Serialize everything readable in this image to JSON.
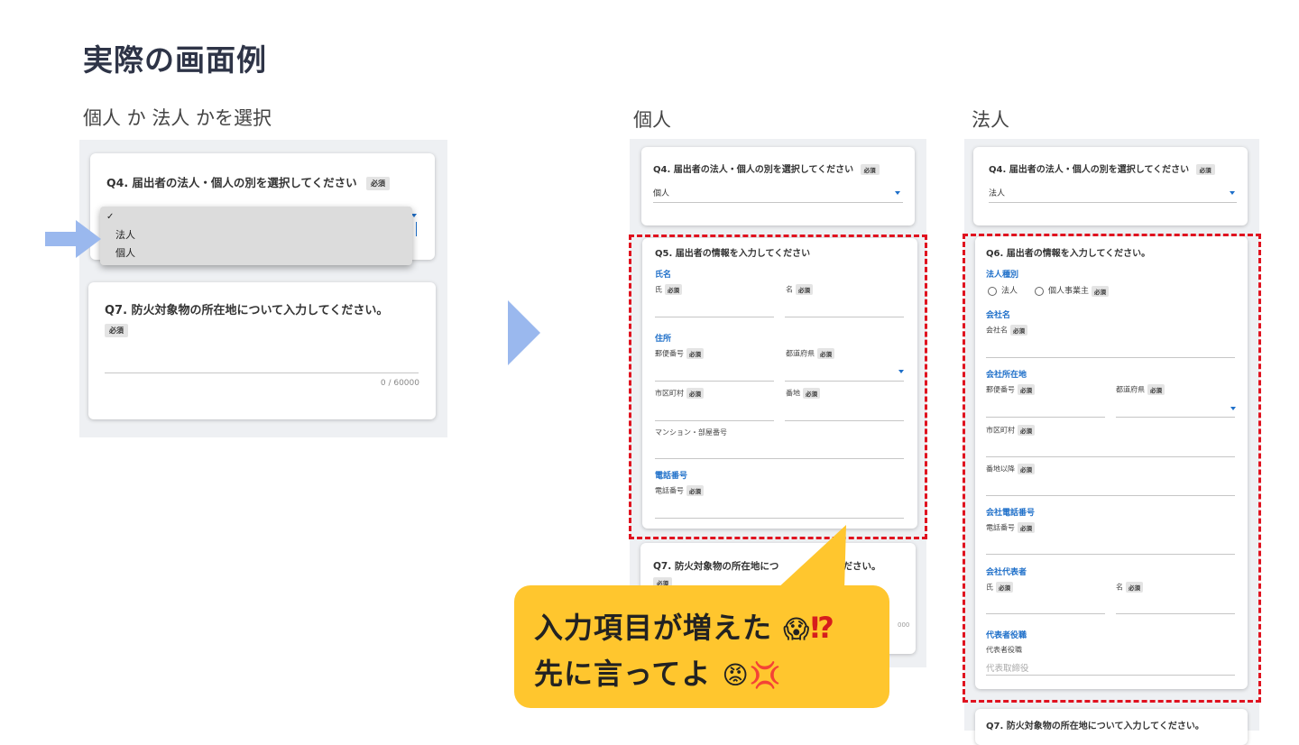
{
  "slide_title": "実際の画面例",
  "captions": {
    "left": "個人 か 法人 かを選択",
    "middle": "個人",
    "right": "法人"
  },
  "required_badge": "必須",
  "left_panel": {
    "q4_title": "Q4. 届出者の法人・個人の別を選択してください",
    "dropdown_options": [
      "✓",
      "法人",
      "個人"
    ],
    "q7_title": "Q7. 防火対象物の所在地について入力してください。",
    "char_counter": "0 / 60000"
  },
  "individual_panel": {
    "q4_title": "Q4. 届出者の法人・個人の別を選択してください",
    "q4_value": "個人",
    "q5_title": "Q5. 届出者の情報を入力してください",
    "name_section": "氏名",
    "last_name": "氏",
    "first_name": "名",
    "address_section": "住所",
    "postal_code": "郵便番号",
    "prefecture": "都道府県",
    "city": "市区町村",
    "street": "番地",
    "building": "マンション・部屋番号",
    "phone_section": "電話番号",
    "phone": "電話番号",
    "q7_title_a": "Q7. 防火対象物の所在地につ",
    "q7_title_b": "ください。",
    "counter_partial": "000"
  },
  "corporate_panel": {
    "q4_title": "Q4. 届出者の法人・個人の別を選択してください",
    "q4_value": "法人",
    "q6_title": "Q6. 届出者の情報を入力してください。",
    "corp_type_section": "法人種別",
    "radio_corporation": "法人",
    "radio_sole_proprietor": "個人事業主",
    "company_name_section": "会社名",
    "company_name": "会社名",
    "company_address_section": "会社所在地",
    "postal_code": "郵便番号",
    "prefecture": "都道府県",
    "city": "市区町村",
    "street_after": "番地以降",
    "company_phone_section": "会社電話番号",
    "phone": "電話番号",
    "representative_section": "会社代表者",
    "last_name": "氏",
    "first_name": "名",
    "rep_title_section": "代表者役職",
    "rep_title": "代表者役職",
    "rep_title_placeholder": "代表取締役",
    "q7_title": "Q7. 防火対象物の所在地について入力してください。"
  },
  "speech_bubble": {
    "line1": "入力項目が増えた",
    "line2": "先に言ってよ",
    "emoji1": "😱",
    "emoji2": "⁉",
    "emoji3": "😡",
    "emoji4": "💢"
  },
  "colors": {
    "accent_blue": "#1e6fc9",
    "arrow_blue": "#9ab8ee",
    "dashed_red": "#e0121f",
    "bubble_yellow": "#ffc62e"
  }
}
